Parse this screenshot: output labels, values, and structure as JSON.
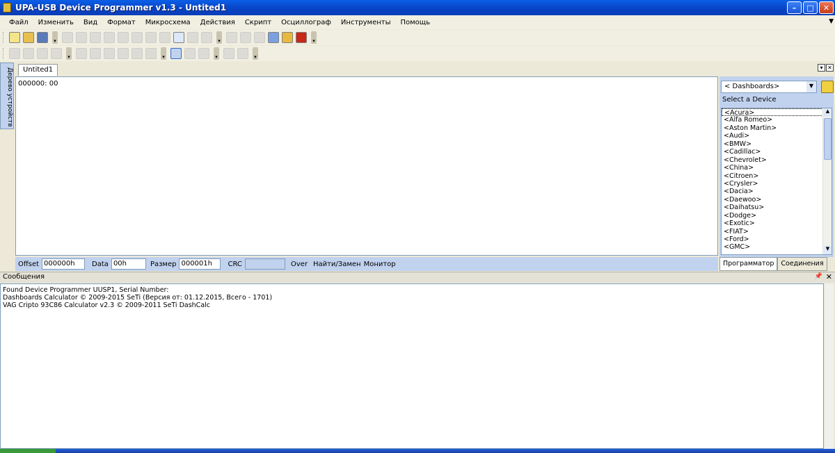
{
  "window": {
    "title": "UPA-USB Device Programmer v1.3 - Untited1"
  },
  "menu": [
    "Файл",
    "Изменить",
    "Вид",
    "Формат",
    "Микросхема",
    "Действия",
    "Скрипт",
    "Осциллограф",
    "Инструменты",
    "Помощь"
  ],
  "left_panel": {
    "label": "Дерево устройств"
  },
  "document": {
    "tab": "Untited1",
    "hex_line": "000000:  00"
  },
  "status": {
    "offset_label": "Offset",
    "offset_value": "000000h",
    "data_label": "Data",
    "data_value": "00h",
    "size_label": "Размер",
    "size_value": "000001h",
    "crc_label": "CRC",
    "crc_value": "",
    "over_label": "Over",
    "find_label": "Найти/Замен",
    "monitor_label": "Монитор"
  },
  "device_panel": {
    "combo_value": "< Dashboards>",
    "select_label": "Select a Device",
    "devices": [
      "<Acura>",
      "<Alfa Romeo>",
      "<Aston Martin>",
      "<Audi>",
      "<BMW>",
      "<Cadillac>",
      "<Chevrolet>",
      "<China>",
      "<Citroen>",
      "<Crysler>",
      "<Dacia>",
      "<Daewoo>",
      "<Daihatsu>",
      "<Dodge>",
      "<Exotic>",
      "<FIAT>",
      "<Ford>",
      "<GMC>"
    ],
    "tabs": [
      "Программатор",
      "Соединения"
    ]
  },
  "messages": {
    "header": "Сообщения",
    "lines": [
      "Found Device Programmer UUSP1, Serial Number:",
      "Dashboards Calculator © 2009-2015 SeTi (Версия от:  01.12.2015, Всего - 1701)",
      "VAG Cripto 93C86 Calculator v2.3 © 2009-2011 SeTi DashCalc"
    ]
  }
}
